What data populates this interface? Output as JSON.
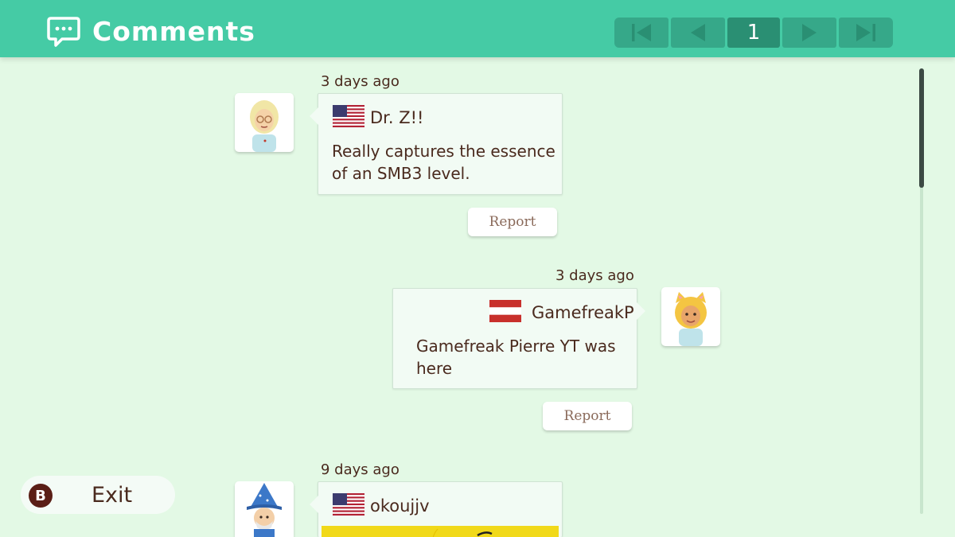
{
  "header": {
    "title": "Comments",
    "icon": "speech-bubble-icon",
    "pager": {
      "current_page": "1",
      "buttons": [
        "first-page-icon",
        "previous-page-icon",
        "next-page-icon",
        "last-page-icon"
      ]
    },
    "colors": {
      "bar": "#45cba5",
      "pager_button": "#36a889",
      "pager_current": "#2a8f73"
    }
  },
  "comments": [
    {
      "timestamp": "3 days ago",
      "flag": "us-flag-icon",
      "username": "Dr. Z!!",
      "text_lines": [
        "Really captures the essence",
        "of an SMB3 level."
      ],
      "report_label": "Report",
      "avatar": "mii-avatar-blonde-glasses"
    },
    {
      "timestamp": "3 days ago",
      "flag": "austria-flag-icon",
      "username": "GamefreakP",
      "text_lines": [
        "Gamefreak Pierre YT was",
        "here"
      ],
      "report_label": "Report",
      "avatar": "mii-avatar-cat-hood"
    },
    {
      "timestamp": "9 days ago",
      "flag": "us-flag-icon",
      "username": "okoujjv",
      "avatar": "mii-avatar-blue-wizard-hat"
    }
  ],
  "footer": {
    "button_glyph": "B",
    "exit_label": "Exit"
  }
}
